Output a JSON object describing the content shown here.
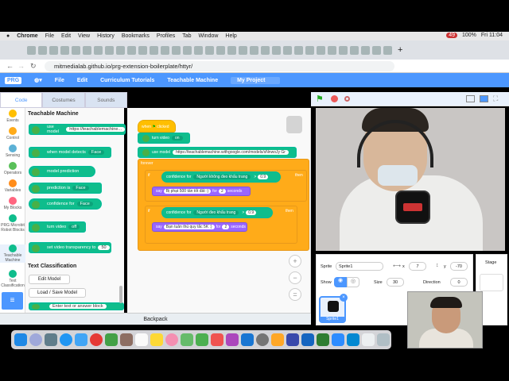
{
  "os_menu": {
    "app": "Chrome",
    "items": [
      "File",
      "Edit",
      "View",
      "History",
      "Bookmarks",
      "Profiles",
      "Tab",
      "Window",
      "Help"
    ],
    "battery": "100%",
    "clock": "Fri 11:04",
    "badge": "49"
  },
  "browser": {
    "url": "mitmedialab.github.io/prg-extension-boilerplate/httyr/"
  },
  "scratch_menu": {
    "file": "File",
    "edit": "Edit",
    "curriculum": "Curriculum Tutorials",
    "teachable": "Teachable Machine",
    "project": "My Project"
  },
  "tabs": {
    "code": "Code",
    "costumes": "Costumes",
    "sounds": "Sounds"
  },
  "categories": [
    {
      "label": "Events",
      "color": "#ffbf00"
    },
    {
      "label": "Control",
      "color": "#ffab19"
    },
    {
      "label": "Sensing",
      "color": "#5cb1d6"
    },
    {
      "label": "Operators",
      "color": "#59c059"
    },
    {
      "label": "Variables",
      "color": "#ff8c1a"
    },
    {
      "label": "My Blocks",
      "color": "#ff6680"
    },
    {
      "label": "PRG Microbit Robot Blocks",
      "color": "#0fbd8c"
    },
    {
      "label": "Teachable Machine",
      "color": "#0fbd8c"
    },
    {
      "label": "Text Classification",
      "color": "#0fbd8c"
    }
  ],
  "palette": {
    "title": "Teachable Machine",
    "use_model": "use model",
    "model_url": "https://teachablemachine...",
    "when_detects": "when model detects",
    "face": "Face",
    "model_prediction": "model prediction",
    "prediction_is": "prediction is",
    "confidence_for": "confidence for",
    "turn_video": "turn video",
    "off": "off",
    "set_transparency": "set video transparency to",
    "transparency_val": "50",
    "section2": "Text Classification",
    "edit_model": "Edit Model",
    "load_save": "Load / Save Model",
    "enter_text": "Enter text or answer block"
  },
  "script": {
    "when": "when",
    "clicked": "clicked",
    "turn_video": "turn video",
    "on": "on",
    "use_model": "use model",
    "url": "https://teachablemachine.withgoogle.com/models/sNnwoJy Gr",
    "forever": "forever",
    "if1": "if",
    "conf1": "confidence for",
    "class1": "Người không đeo khẩu trang",
    "gt1": ">",
    "v1": "0.9",
    "then1": "then",
    "say1": "say",
    "msg1": "Bị phạt 500 tấn tốt đất :)",
    "for1": "for",
    "sec1": "2",
    "seconds1": "seconds",
    "if2": "if",
    "conf2": "confidence for",
    "class2": "Người đeo khẩu trang",
    "gt2": ">",
    "v2": "0.9",
    "then2": "then",
    "say2": "say",
    "msg2": "Bạn tuân thủ quy tắc 5K :)",
    "for2": "for",
    "sec2": "2",
    "seconds2": "seconds"
  },
  "sprite_info": {
    "sprite_label": "Sprite",
    "sprite_name": "Sprite1",
    "x_label": "x",
    "x_val": "7",
    "y_label": "y",
    "y_val": "-70",
    "show_label": "Show",
    "size_label": "Size",
    "size_val": "30",
    "direction_label": "Direction",
    "direction_val": "0",
    "thumb_label": "Sprite1",
    "stage_label": "Stage"
  },
  "backpack": "Backpack",
  "colors": {
    "scratch_blue": "#4c97ff",
    "ml_green": "#0fbd8c",
    "control": "#ffab19",
    "looks": "#9966ff"
  }
}
